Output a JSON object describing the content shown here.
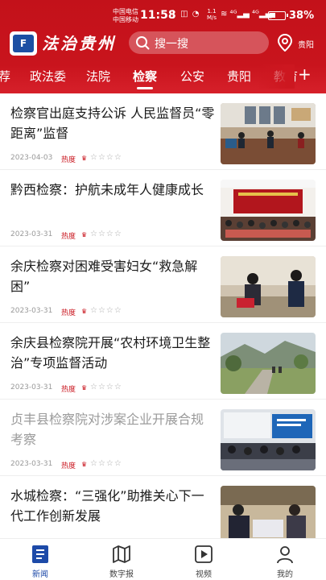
{
  "status_bar": {
    "carrier_1": "中国电信",
    "carrier_2": "中国移动",
    "time": "11:58",
    "icons": "ᛒ ◫ ◔",
    "net_speed_value": "1.1",
    "net_speed_unit": "M/s",
    "signal": "≋ ⁴ᴳ▂▄ ⁴ᴳ▂▄",
    "battery_level": 0.38,
    "battery_percent": "38%"
  },
  "header": {
    "logo_text": "F",
    "brand": "法治贵州",
    "search_placeholder": "搜一搜",
    "location": "贵阳",
    "accent_color": "#c9141d",
    "tabs": [
      "荐",
      "政法委",
      "法院",
      "检察",
      "公安",
      "贵阳",
      "教育"
    ],
    "active_tab_index": 3,
    "more_tabs": "+"
  },
  "feed": {
    "heat_label": "热度",
    "items": [
      {
        "title": "检察官出庭支持公诉  人民监督员“零距离”监督",
        "date": "2023-04-03",
        "rating": 1,
        "read": false
      },
      {
        "title": "黔西检察：护航未成年人健康成长",
        "date": "2023-03-31",
        "rating": 1,
        "read": false
      },
      {
        "title": "余庆检察对困难受害妇女“救急解困”",
        "date": "2023-03-31",
        "rating": 1,
        "read": false
      },
      {
        "title": "余庆县检察院开展“农村环境卫生整治”专项监督活动",
        "date": "2023-03-31",
        "rating": 1,
        "read": false
      },
      {
        "title": "贞丰县检察院对涉案企业开展合规考察",
        "date": "2023-03-31",
        "rating": 1,
        "read": true
      },
      {
        "title": "水城检察：“三强化”助推关心下一代工作创新发展",
        "date": "",
        "rating": 0,
        "read": false
      }
    ]
  },
  "bottom_nav": {
    "items": [
      {
        "label": "新闻",
        "icon": "news-icon"
      },
      {
        "label": "数字报",
        "icon": "map-icon"
      },
      {
        "label": "视频",
        "icon": "video-icon"
      },
      {
        "label": "我的",
        "icon": "user-icon"
      }
    ],
    "active_index": 0,
    "active_color": "#1d4aa8"
  }
}
